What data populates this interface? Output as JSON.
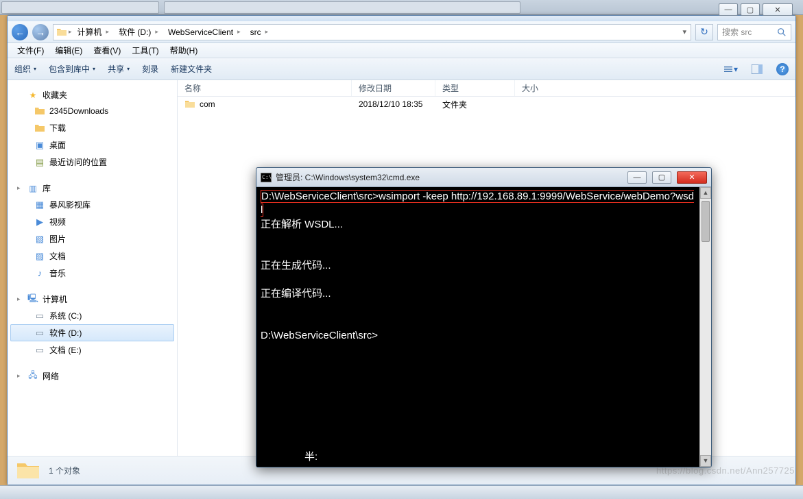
{
  "explorer": {
    "win_controls": {
      "min": "—",
      "max": "▢",
      "close": "✕"
    },
    "breadcrumb": {
      "segments": [
        "计算机",
        "软件 (D:)",
        "WebServiceClient",
        "src"
      ],
      "sep": "▸"
    },
    "refresh_glyph": "↻",
    "search": {
      "placeholder": "搜索 src"
    },
    "menu": {
      "file": "文件(F)",
      "edit": "编辑(E)",
      "view": "查看(V)",
      "tools": "工具(T)",
      "help": "帮助(H)"
    },
    "toolbar": {
      "organize": "组织",
      "include": "包含到库中",
      "share": "共享",
      "burn": "刻录",
      "newfolder": "新建文件夹",
      "dd": "▾",
      "help_glyph": "?"
    },
    "sidebar": {
      "favorites": {
        "label": "收藏夹",
        "items": [
          "2345Downloads",
          "下载",
          "桌面",
          "最近访问的位置"
        ]
      },
      "libraries": {
        "label": "库",
        "items": [
          "暴风影视库",
          "视频",
          "图片",
          "文档",
          "音乐"
        ]
      },
      "computer": {
        "label": "计算机",
        "items": [
          "系统 (C:)",
          "软件 (D:)",
          "文档 (E:)"
        ],
        "selected_index": 1
      },
      "network": {
        "label": "网络"
      }
    },
    "columns": {
      "name": "名称",
      "date": "修改日期",
      "type": "类型",
      "size": "大小"
    },
    "files": [
      {
        "name": "com",
        "date": "2018/12/10 18:35",
        "type": "文件夹",
        "size": ""
      }
    ],
    "status": {
      "count": "1 个对象"
    }
  },
  "cmd": {
    "title": "管理员: C:\\Windows\\system32\\cmd.exe",
    "win_controls": {
      "min": "—",
      "max": "▢",
      "close": "✕"
    },
    "prompt1_a": "D:\\WebServiceClient\\src>",
    "prompt1_b": "wsimport -keep http://192.168.89.1:9999/WebService/webDemo?wsdl",
    "line_parse": "正在解析 WSDL...",
    "line_gen": "正在生成代码...",
    "line_comp": "正在编译代码...",
    "prompt2": "D:\\WebServiceClient\\src>",
    "line_bottom": "半:"
  },
  "watermark": "https://blog.csdn.net/Ann257725"
}
